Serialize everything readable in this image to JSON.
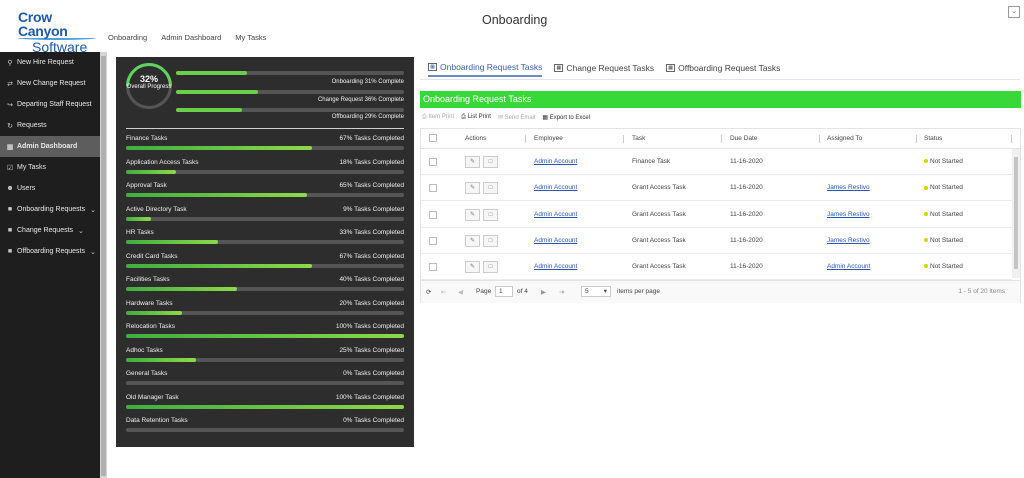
{
  "header": {
    "logo_top": "Crow Canyon",
    "logo_bottom": "Software",
    "nav": [
      "Onboarding",
      "Admin Dashboard",
      "My Tasks"
    ],
    "title": "Onboarding"
  },
  "sidebar": {
    "items": [
      {
        "label": "New Hire Request",
        "icon": "person-icon"
      },
      {
        "label": "New Change Request",
        "icon": "change-icon"
      },
      {
        "label": "Departing Staff Request",
        "icon": "exit-icon"
      },
      {
        "label": "Requests",
        "icon": "requests-icon"
      },
      {
        "label": "Admin Dashboard",
        "icon": "dashboard-icon",
        "active": true
      },
      {
        "label": "My Tasks",
        "icon": "checkbox-icon"
      },
      {
        "label": "Users",
        "icon": "users-icon"
      },
      {
        "label": "Onboarding Requests",
        "icon": "document-icon"
      },
      {
        "label": "Change Requests",
        "icon": "document-icon"
      },
      {
        "label": "Offboarding Requests",
        "icon": "document-icon"
      }
    ]
  },
  "progress": {
    "overall_pct": "32%",
    "overall_label": "Overall Progress",
    "summary": [
      {
        "label": "Onboarding  31% Complete",
        "value": 0.31
      },
      {
        "label": "Change Request  36% Complete",
        "value": 0.36
      },
      {
        "label": "Offboarding  29% Complete",
        "value": 0.29
      }
    ],
    "tasks": [
      {
        "name": "Finance Tasks",
        "count": "67% Tasks Completed",
        "value": 0.67
      },
      {
        "name": "Application Access Tasks",
        "count": "18% Tasks Completed",
        "value": 0.18
      },
      {
        "name": "Approval Task",
        "count": "65% Tasks Completed",
        "value": 0.65
      },
      {
        "name": "Active Directory Task",
        "count": "9% Tasks Completed",
        "value": 0.09
      },
      {
        "name": "HR Tasks",
        "count": "33% Tasks Completed",
        "value": 0.33
      },
      {
        "name": "Credit Card Tasks",
        "count": "67% Tasks Completed",
        "value": 0.67
      },
      {
        "name": "Facilities Tasks",
        "count": "40% Tasks Completed",
        "value": 0.4
      },
      {
        "name": "Hardware Tasks",
        "count": "20% Tasks Completed",
        "value": 0.2
      },
      {
        "name": "Relocation Tasks",
        "count": "100% Tasks Completed",
        "value": 1.0
      },
      {
        "name": "Adhoc Tasks",
        "count": "25% Tasks Completed",
        "value": 0.25
      },
      {
        "name": "General Tasks",
        "count": "0% Tasks Completed",
        "value": 0.0
      },
      {
        "name": "Old Manager Task",
        "count": "100% Tasks Completed",
        "value": 1.0
      },
      {
        "name": "Data Retention Tasks",
        "count": "0% Tasks Completed",
        "value": 0.0
      }
    ]
  },
  "tabs": [
    "Onboarding Request Tasks",
    "Change Request Tasks",
    "Offboarding Request Tasks"
  ],
  "section_title": "Onboarding Request Tasks",
  "toolbar": {
    "item_print": "Item Print",
    "list_print": "List Print",
    "send_email": "Send Email",
    "export": "Export to Excel"
  },
  "grid": {
    "columns": [
      "Actions",
      "Employee",
      "Task",
      "Due Date",
      "Assigned To",
      "Status"
    ],
    "rows": [
      {
        "employee": "Admin Account",
        "task": "Finance Task",
        "due": "11-16-2020",
        "assigned": "",
        "status": "Not Started"
      },
      {
        "employee": "Admin Account",
        "task": "Grant Access Task",
        "due": "11-16-2020",
        "assigned": "James Restivo",
        "status": "Not Started"
      },
      {
        "employee": "Admin Account",
        "task": "Grant Access Task",
        "due": "11-16-2020",
        "assigned": "James Restivo",
        "status": "Not Started"
      },
      {
        "employee": "Admin Account",
        "task": "Grant Access Task",
        "due": "11-16-2020",
        "assigned": "James Restivo",
        "status": "Not Started"
      },
      {
        "employee": "Admin Account",
        "task": "Grant Access Task",
        "due": "11-16-2020",
        "assigned": "Admin Account",
        "status": "Not Started"
      }
    ]
  },
  "pager": {
    "page_label": "Page",
    "page": "1",
    "of": "of 4",
    "per_page": "5",
    "per_page_label": "items per page",
    "range": "1 - 5 of 20 items"
  },
  "colors": {
    "accent_green": "#38d838",
    "sidebar_bg": "#1e1e1e",
    "panel_bg": "#2d2d2d",
    "link": "#2a55b0"
  }
}
